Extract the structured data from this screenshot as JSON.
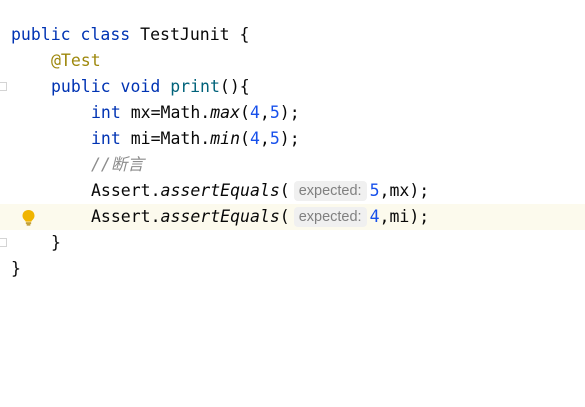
{
  "editor": {
    "lines": {
      "class_decl": {
        "kw1": "public",
        "kw2": "class",
        "name": "TestJunit",
        "brace": "{"
      },
      "annotation": {
        "text": "@Test"
      },
      "method_decl": {
        "kw1": "public",
        "kw2": "void",
        "name": "print",
        "rest": "(){"
      },
      "mx_line": {
        "type": "int",
        "lhs": "mx=Math.",
        "method": "max",
        "open": "(",
        "a": "4",
        "comma": ",",
        "b": "5",
        "close": ");"
      },
      "mi_line": {
        "type": "int",
        "lhs": "mi=Math.",
        "method": "min",
        "open": "(",
        "a": "4",
        "comma": ",",
        "b": "5",
        "close": ");"
      },
      "comment": {
        "text": "//断言"
      },
      "assert1": {
        "cls": "Assert.",
        "method": "assertEquals",
        "open": "(",
        "hint": "expected:",
        "value": "5",
        "rest": ",mx);"
      },
      "assert2": {
        "cls": "Assert.",
        "method": "assertEquals",
        "open": "(",
        "hint": "expected:",
        "value": "4",
        "rest": ",mi);"
      },
      "method_close": {
        "text": "}"
      },
      "class_close": {
        "text": "}"
      }
    },
    "icons": {
      "bulb": "intention-bulb-icon",
      "fold": "fold-marker-icon"
    },
    "colors": {
      "keyword": "#0033b3",
      "annotation": "#9e880d",
      "function": "#00627a",
      "number": "#1750eb",
      "comment": "#8c8c8c",
      "current_line": "#fcfaed",
      "bulb": "#f0b400"
    }
  }
}
